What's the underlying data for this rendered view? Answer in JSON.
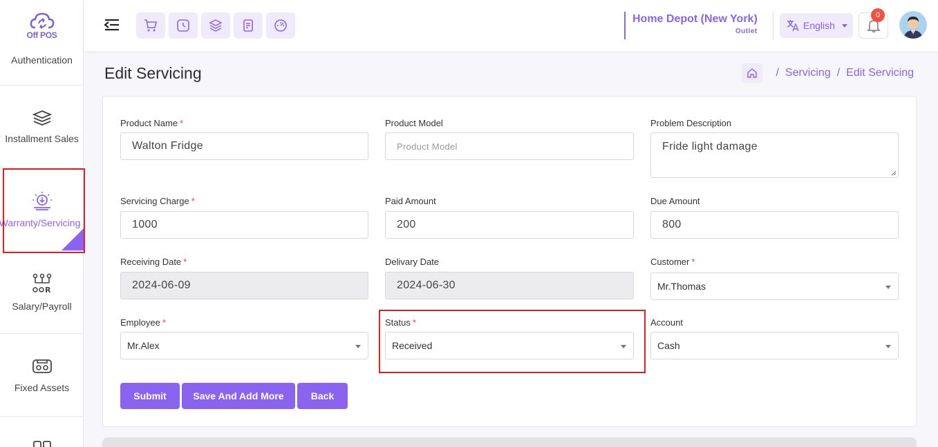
{
  "app": {
    "logo_text": "Off POS"
  },
  "sidebar": {
    "items": [
      {
        "label": "Authentication",
        "icon": "authentication-icon"
      },
      {
        "label": "Installment Sales",
        "icon": "layers-icon"
      },
      {
        "label": "Warranty/Servicing",
        "icon": "servicing-icon",
        "active": true
      },
      {
        "label": "Salary/Payroll",
        "icon": "payroll-icon"
      },
      {
        "label": "Fixed Assets",
        "icon": "fixed-assets-icon"
      }
    ]
  },
  "header": {
    "quick_actions": [
      "cart-icon",
      "clock-icon",
      "layers-icon",
      "receipt-icon",
      "dashboard-icon"
    ],
    "store_name": "Home Depot (New York)",
    "store_type": "Outlet",
    "language": "English",
    "notification_count": "0"
  },
  "page": {
    "title": "Edit Servicing",
    "breadcrumb": [
      "Servicing",
      "Edit Servicing"
    ]
  },
  "form": {
    "product_name": {
      "label": "Product Name",
      "required": "*",
      "value": "Walton Fridge"
    },
    "product_model": {
      "label": "Product Model",
      "placeholder": "Product Model"
    },
    "problem_description": {
      "label": "Problem Description",
      "value": "Fride light damage"
    },
    "servicing_charge": {
      "label": "Servicing Charge",
      "required": "*",
      "value": "1000"
    },
    "paid_amount": {
      "label": "Paid Amount",
      "value": "200"
    },
    "due_amount": {
      "label": "Due Amount",
      "value": "800"
    },
    "receiving_date": {
      "label": "Receiving Date",
      "required": "*",
      "value": "2024-06-09"
    },
    "delivery_date": {
      "label": "Delivary Date",
      "value": "2024-06-30"
    },
    "customer": {
      "label": "Customer",
      "required": "*",
      "value": "Mr.Thomas"
    },
    "employee": {
      "label": "Employee",
      "required": "*",
      "value": "Mr.Alex"
    },
    "status": {
      "label": "Status",
      "required": "*",
      "value": "Received"
    },
    "account": {
      "label": "Account",
      "value": "Cash"
    }
  },
  "actions": {
    "submit": "Submit",
    "save_add_more": "Save And Add More",
    "back": "Back"
  },
  "colors": {
    "accent": "#8a63f0",
    "highlight": "#e02020",
    "badge": "#f2513f"
  }
}
